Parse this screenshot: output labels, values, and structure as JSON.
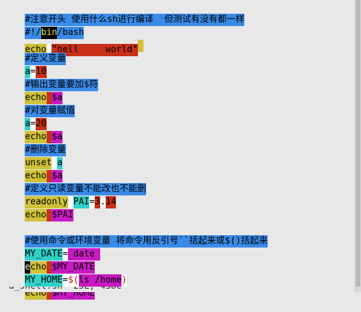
{
  "lines": [
    {
      "segments": [
        "#注意开头 使用什么sh进行编译  但测试有没有都一样"
      ]
    },
    {
      "segments": [
        "#!/",
        "bin",
        "/bash"
      ]
    },
    {
      "segments": [
        "echo",
        " ",
        "\"hell     world\"",
        ""
      ]
    },
    {
      "segments": [
        "#定义变量"
      ]
    },
    {
      "segments": [
        "a",
        "=",
        "10"
      ]
    },
    {
      "segments": [
        "#输出变量要加$符"
      ]
    },
    {
      "segments": [
        "echo",
        " ",
        "$a"
      ]
    },
    {
      "segments": [
        "#对变量赋值"
      ]
    },
    {
      "segments": [
        "a",
        "=",
        "20"
      ]
    },
    {
      "segments": [
        "echo",
        " ",
        "$a"
      ]
    },
    {
      "segments": [
        "#删除变量"
      ]
    },
    {
      "segments": [
        "unset",
        " ",
        "a"
      ]
    },
    {
      "segments": [
        "echo",
        " ",
        "$a"
      ]
    },
    {
      "segments": [
        "#定义只读变量不能改也不能删"
      ]
    },
    {
      "segments": [
        "readonly",
        " ",
        "PAI",
        "=",
        "3",
        ".",
        "14"
      ]
    },
    {
      "segments": [
        "echo",
        " ",
        "$PAI"
      ]
    },
    {
      "segments": [
        ""
      ]
    },
    {
      "segments": [
        "#使用命令或环境变量 将命令用反引号``括起来或$()括起来"
      ]
    },
    {
      "segments": [
        "MY_DATE",
        "=",
        " date "
      ]
    },
    {
      "segments": [
        "e",
        "cho",
        " ",
        "$MY_DATE"
      ]
    },
    {
      "segments": [
        "MY_HOME",
        "=",
        "$(",
        "ls /home",
        ")"
      ]
    },
    {
      "segments": [
        "echo",
        " ",
        "$MY_HOME"
      ]
    }
  ],
  "status_line": "\"a_shell.sh\" 25L, 438C"
}
